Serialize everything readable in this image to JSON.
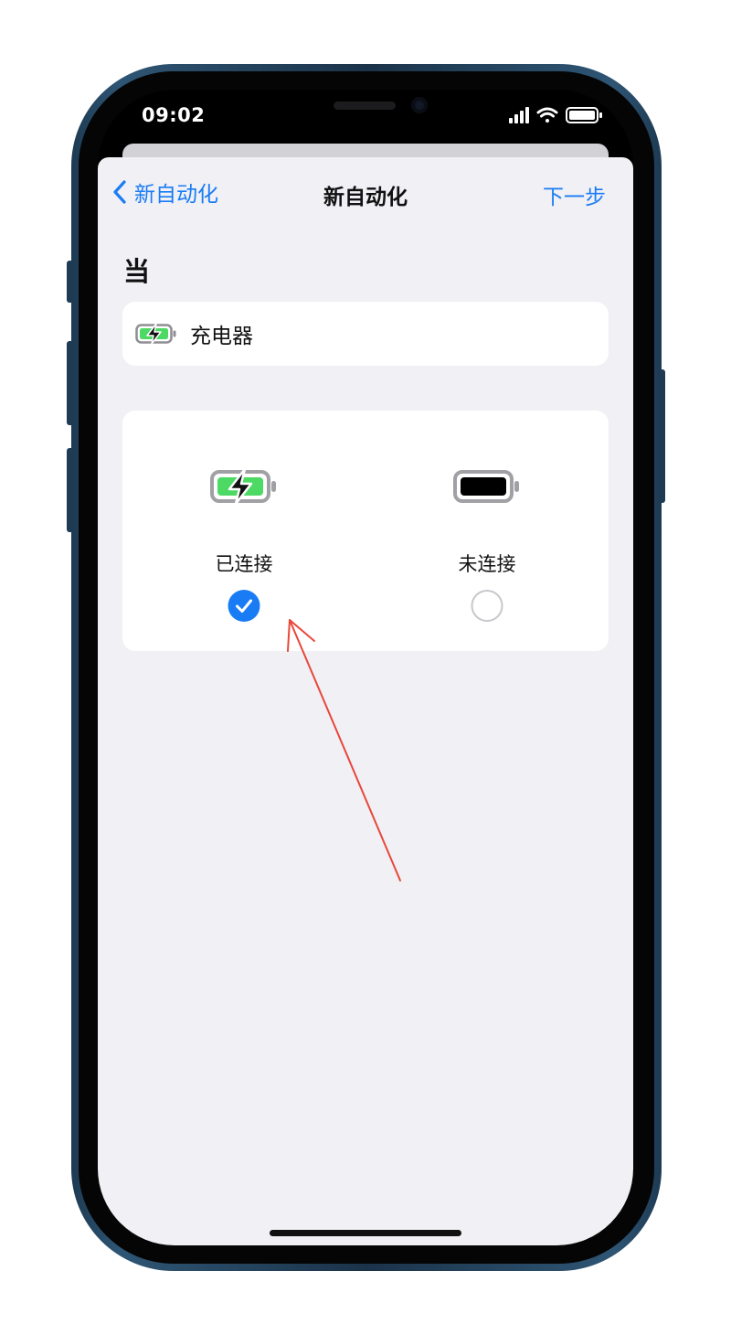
{
  "status_bar": {
    "time": "09:02",
    "icons": [
      "cellular-signal-icon",
      "wifi-icon",
      "battery-icon"
    ]
  },
  "nav": {
    "back_label": "新自动化",
    "title": "新自动化",
    "next_label": "下一步"
  },
  "section": {
    "title": "当"
  },
  "trigger": {
    "icon": "battery-charging-icon",
    "label": "充电器"
  },
  "options": [
    {
      "label": "已连接",
      "icon": "battery-charging-icon",
      "selected": true
    },
    {
      "label": "未连接",
      "icon": "battery-full-icon",
      "selected": false
    }
  ],
  "colors": {
    "accent": "#1a7cf5",
    "charging_green": "#4cd964",
    "sheet_background": "#f0f0f5",
    "annotation_arrow": "#e8473a"
  }
}
